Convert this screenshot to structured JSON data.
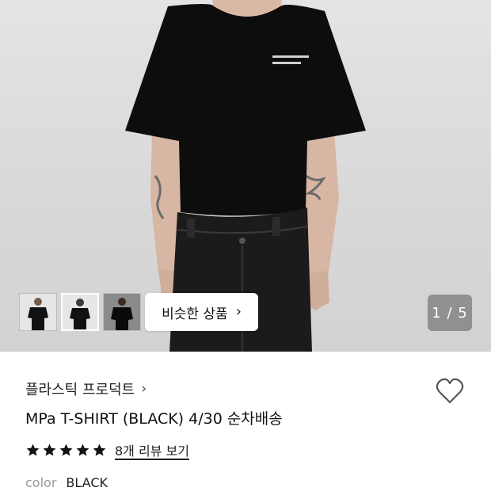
{
  "gallery": {
    "similar_label": "비슷한 상품",
    "chevron": "›",
    "counter": "1 / 5",
    "thumbnails": [
      "front-view",
      "front-view",
      "front-view-dark"
    ]
  },
  "product": {
    "brand": "플라스틱 프로덕트",
    "brand_chevron": "›",
    "title": "MPa T-SHIRT (BLACK) 4/30 순차배송",
    "rating_stars": 5,
    "review_link": "8개 리뷰 보기",
    "color_label": "color",
    "color_value": "BLACK"
  },
  "icons": {
    "heart": "heart-outline-icon",
    "star": "star-filled-icon",
    "chevron": "chevron-right-icon"
  },
  "colors": {
    "text_primary": "#111111",
    "muted": "#9a9a9a",
    "star": "#111111"
  }
}
